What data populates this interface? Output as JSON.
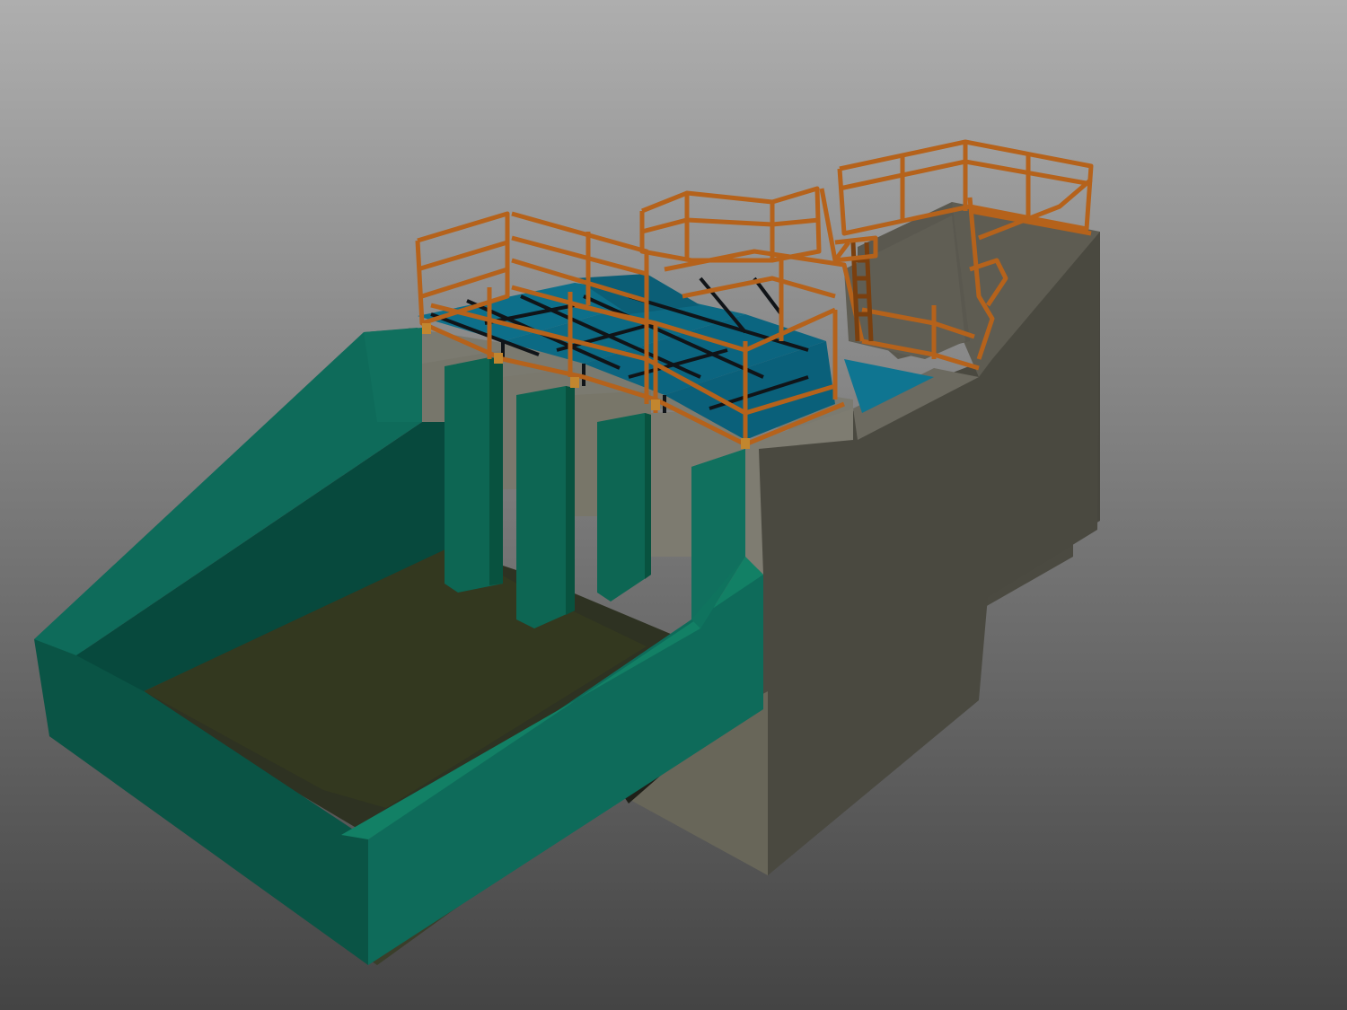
{
  "scene": {
    "kind": "3d-render",
    "colors": {
      "background_top": "#aeaeae",
      "background_bottom": "#444444",
      "concrete_light": "#7d7b72",
      "concrete_mid": "#5d5b52",
      "concrete_dark": "#45443c",
      "concrete_shadow": "#36352e",
      "channel_teal": "#0e6b5a",
      "channel_teal_dark": "#07493d",
      "channel_teal_light": "#1a8570",
      "channel_floor": "#2e3222",
      "channel_floor_dark": "#1f2218",
      "water_blue": "#0d6f8a",
      "water_blue_dark": "#0a556a",
      "railing_orange": "#b5621b",
      "railing_dark": "#7a3f0e",
      "beam_black": "#101418"
    }
  }
}
